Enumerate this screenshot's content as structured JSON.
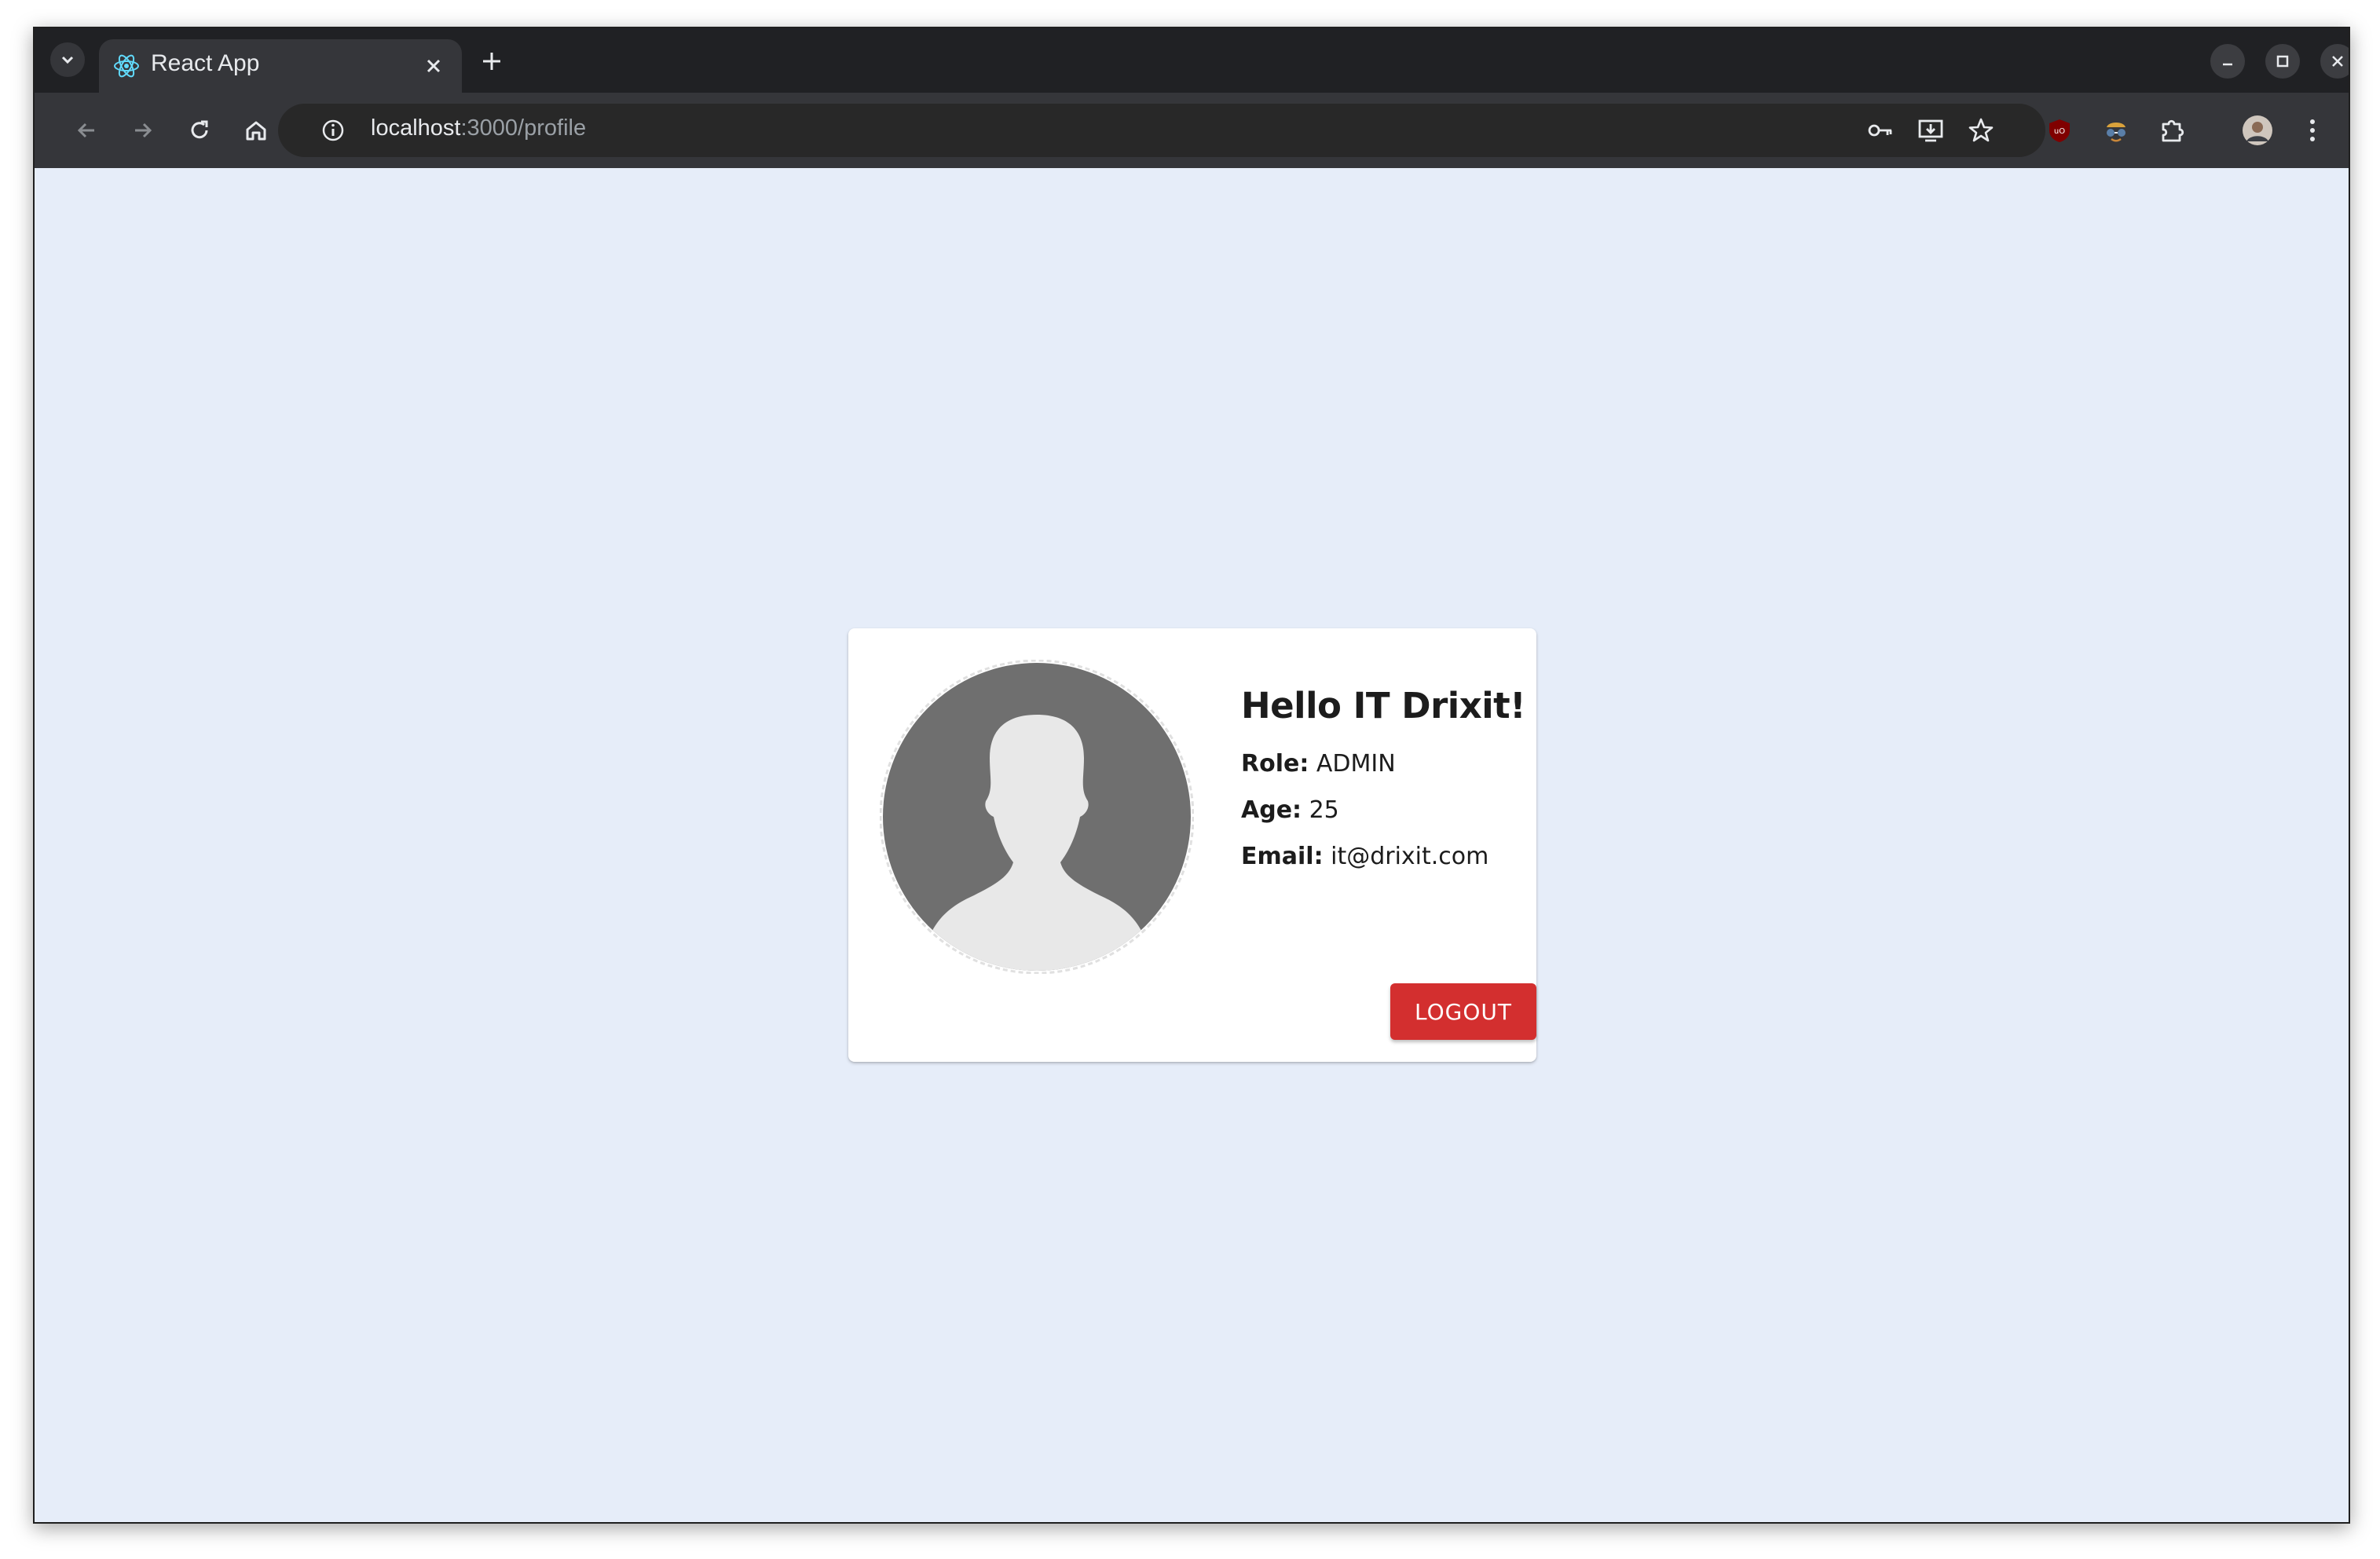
{
  "browser": {
    "tab": {
      "title": "React App",
      "favicon": "react-icon"
    },
    "address": {
      "host": "localhost",
      "path": ":3000/profile"
    },
    "toolbar_icons": [
      "back-icon",
      "forward-icon",
      "reload-icon",
      "home-icon",
      "site-info-icon",
      "password-key-icon",
      "install-app-icon",
      "bookmark-star-icon",
      "ublock-icon",
      "extension-spy-icon",
      "extensions-puzzle-icon",
      "profile-avatar-icon",
      "menu-dots-icon"
    ]
  },
  "profile": {
    "greeting": "Hello IT Drixit!",
    "role_label": "Role:",
    "role_value": "ADMIN",
    "age_label": "Age:",
    "age_value": "25",
    "email_label": "Email:",
    "email_value": "it@drixit.com",
    "logout_label": "LOGOUT",
    "avatar": "user-silhouette-icon"
  },
  "colors": {
    "page_background": "#e6edf9",
    "logout_button": "#d32f2f",
    "avatar_circle": "#6f6f6f",
    "avatar_silhouette": "#e8e8e8"
  }
}
